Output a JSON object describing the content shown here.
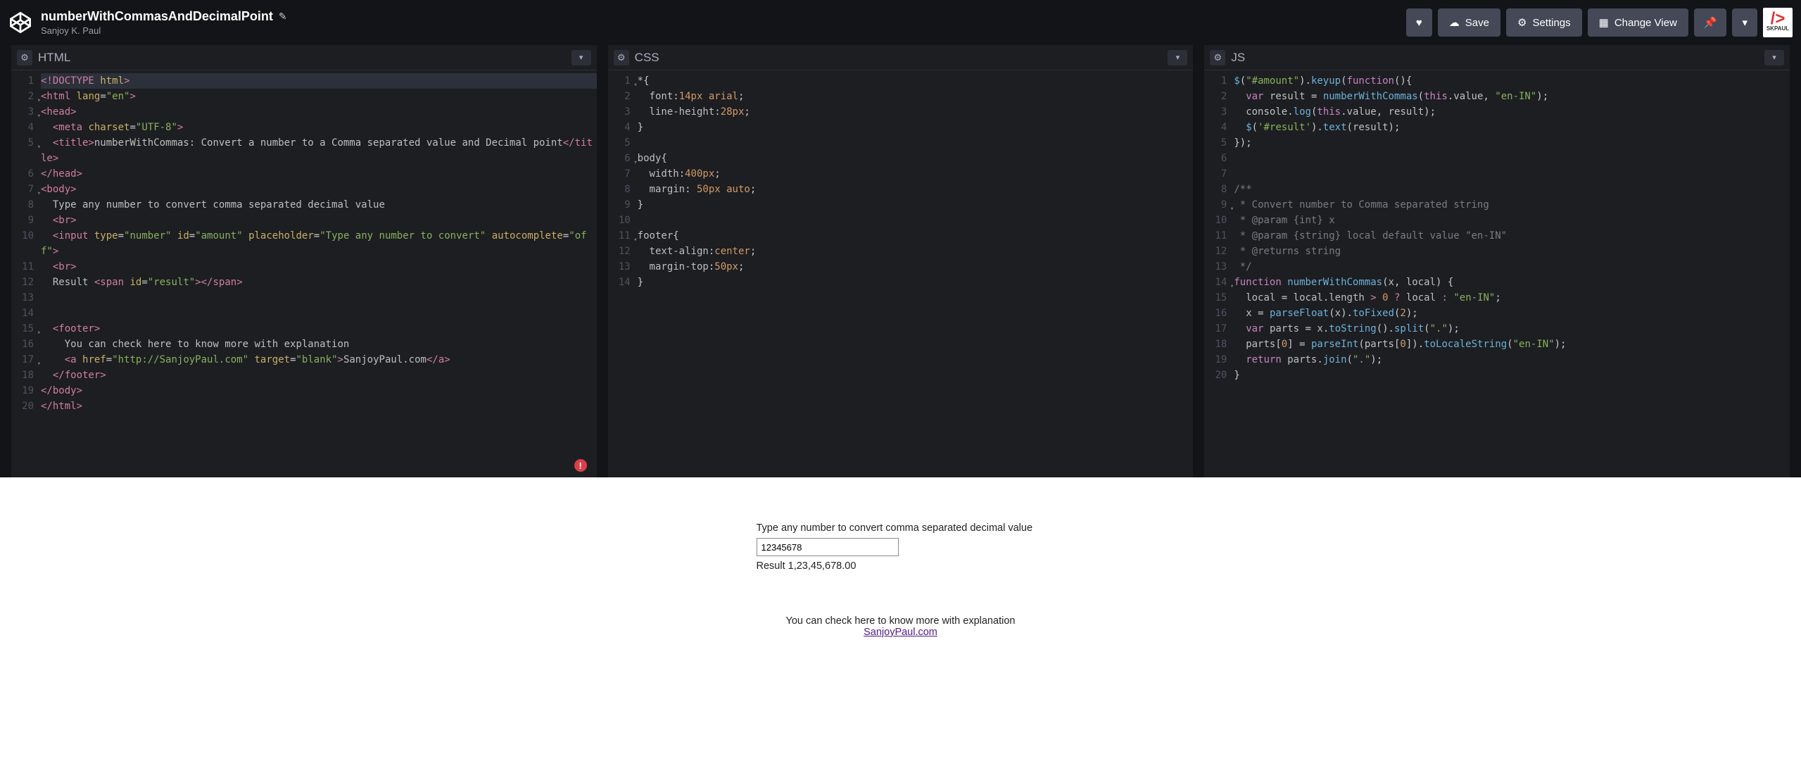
{
  "header": {
    "title": "numberWithCommasAndDecimalPoint",
    "author": "Sanjoy K. Paul",
    "save": "Save",
    "settings": "Settings",
    "changeView": "Change View",
    "avatarText": "SKPAUL"
  },
  "panes": {
    "html": {
      "title": "HTML"
    },
    "css": {
      "title": "CSS"
    },
    "js": {
      "title": "JS"
    }
  },
  "htmlLines": [
    {
      "n": "1",
      "cls": "cursor",
      "html": "<span class='tag'>&lt;!DOCTYPE</span> <span class='attr'>html</span><span class='tag'>&gt;</span>"
    },
    {
      "n": "2",
      "fold": true,
      "html": "<span class='tag'>&lt;html</span> <span class='attr'>lang</span>=<span class='str'>\"en\"</span><span class='tag'>&gt;</span>"
    },
    {
      "n": "3",
      "fold": true,
      "html": "<span class='tag'>&lt;head&gt;</span>"
    },
    {
      "n": "4",
      "html": "  <span class='tag'>&lt;meta</span> <span class='attr'>charset</span>=<span class='str'>\"UTF-8\"</span><span class='tag'>&gt;</span>"
    },
    {
      "n": "5",
      "fold": true,
      "html": "  <span class='tag'>&lt;title&gt;</span><span class='txt'>numberWithCommas: Convert a number to a Comma separated value and Decimal point</span><span class='tag'>&lt;/title&gt;</span>"
    },
    {
      "n": "6",
      "html": "<span class='tag'>&lt;/head&gt;</span>"
    },
    {
      "n": "7",
      "fold": true,
      "html": "<span class='tag'>&lt;body&gt;</span>"
    },
    {
      "n": "8",
      "html": "  <span class='txt'>Type any number to convert comma separated decimal value</span>"
    },
    {
      "n": "9",
      "html": "  <span class='tag'>&lt;br&gt;</span>"
    },
    {
      "n": "10",
      "html": "  <span class='tag'>&lt;input</span> <span class='attr'>type</span>=<span class='str'>\"number\"</span> <span class='attr'>id</span>=<span class='str'>\"amount\"</span> <span class='attr'>placeholder</span>=<span class='str'>\"Type any number to convert\"</span> <span class='attr'>autocomplete</span>=<span class='str'>\"off\"</span><span class='tag'>&gt;</span>"
    },
    {
      "n": "11",
      "html": "  <span class='tag'>&lt;br&gt;</span>"
    },
    {
      "n": "12",
      "html": "  <span class='txt'>Result </span><span class='tag'>&lt;span</span> <span class='attr'>id</span>=<span class='str'>\"result\"</span><span class='tag'>&gt;&lt;/span&gt;</span>"
    },
    {
      "n": "13",
      "html": "  "
    },
    {
      "n": "14",
      "html": "  "
    },
    {
      "n": "15",
      "fold": true,
      "html": "  <span class='tag'>&lt;footer&gt;</span>"
    },
    {
      "n": "16",
      "html": "    <span class='txt'>You can check here to know more with explanation</span>"
    },
    {
      "n": "17",
      "fold": true,
      "html": "    <span class='tag'>&lt;a</span> <span class='attr'>href</span>=<span class='str'>\"http://SanjoyPaul.com\"</span> <span class='attr'>target</span>=<span class='str'>\"blank\"</span><span class='tag'>&gt;</span><span class='txt'>SanjoyPaul.com</span><span class='tag'>&lt;/a&gt;</span>"
    },
    {
      "n": "18",
      "html": "  <span class='tag'>&lt;/footer&gt;</span>"
    },
    {
      "n": "19",
      "html": "<span class='tag'>&lt;/body&gt;</span>"
    },
    {
      "n": "20",
      "html": "<span class='tag'>&lt;/html&gt;</span>"
    }
  ],
  "cssLines": [
    {
      "n": "1",
      "fold": true,
      "html": "<span class='prop'>*</span>{"
    },
    {
      "n": "2",
      "html": "  <span class='prop'>font</span>:<span class='val'>14px</span> <span class='val'>arial</span>;"
    },
    {
      "n": "3",
      "html": "  <span class='prop'>line-height</span>:<span class='val'>28px</span>;"
    },
    {
      "n": "4",
      "html": "}"
    },
    {
      "n": "5",
      "html": ""
    },
    {
      "n": "6",
      "fold": true,
      "html": "<span class='prop'>body</span>{"
    },
    {
      "n": "7",
      "html": "  <span class='prop'>width</span>:<span class='val'>400px</span>;"
    },
    {
      "n": "8",
      "html": "  <span class='prop'>margin</span>: <span class='val'>50px</span> <span class='val'>auto</span>;"
    },
    {
      "n": "9",
      "html": "}"
    },
    {
      "n": "10",
      "html": ""
    },
    {
      "n": "11",
      "fold": true,
      "html": "<span class='prop'>footer</span>{"
    },
    {
      "n": "12",
      "html": "  <span class='prop'>text-align</span>:<span class='val'>center</span>;"
    },
    {
      "n": "13",
      "html": "  <span class='prop'>margin-top</span>:<span class='val'>50px</span>;"
    },
    {
      "n": "14",
      "html": "}"
    }
  ],
  "jsLines": [
    {
      "n": "1",
      "html": "<span class='fn'>$</span>(<span class='str'>\"#amount\"</span>).<span class='fn'>keyup</span>(<span class='kw'>function</span>(){"
    },
    {
      "n": "2",
      "html": "  <span class='kw'>var</span> <span class='var'>result</span> = <span class='fn'>numberWithCommas</span>(<span class='kw'>this</span>.<span class='var'>value</span>, <span class='str'>\"en-IN\"</span>);"
    },
    {
      "n": "3",
      "html": "  <span class='var'>console</span>.<span class='fn'>log</span>(<span class='kw'>this</span>.<span class='var'>value</span>, <span class='var'>result</span>);"
    },
    {
      "n": "4",
      "html": "  <span class='fn'>$</span>(<span class='str'>'#result'</span>).<span class='fn'>text</span>(<span class='var'>result</span>);"
    },
    {
      "n": "5",
      "html": "});"
    },
    {
      "n": "6",
      "html": ""
    },
    {
      "n": "7",
      "html": ""
    },
    {
      "n": "8",
      "html": "<span class='cmt'>/**</span>"
    },
    {
      "n": "9",
      "fold": true,
      "html": "<span class='cmt'> * Convert number to Comma separated string</span>"
    },
    {
      "n": "10",
      "html": "<span class='cmt'> * @param {int} x</span>"
    },
    {
      "n": "11",
      "html": "<span class='cmt'> * @param {string} local default value \"en-IN\"</span>"
    },
    {
      "n": "12",
      "html": "<span class='cmt'> * @returns string</span>"
    },
    {
      "n": "13",
      "html": "<span class='cmt'> */</span>"
    },
    {
      "n": "14",
      "fold": true,
      "html": "<span class='kw'>function</span> <span class='fn'>numberWithCommas</span>(<span class='var'>x</span>, <span class='var'>local</span>) {"
    },
    {
      "n": "15",
      "html": "  <span class='var'>local</span> = <span class='var'>local</span>.<span class='var'>length</span> <span class='op'>&gt;</span> <span class='num'>0</span> <span class='op'>?</span> <span class='var'>local</span> <span class='op'>:</span> <span class='str'>\"en-IN\"</span>;"
    },
    {
      "n": "16",
      "html": "  <span class='var'>x</span> = <span class='fn'>parseFloat</span>(<span class='var'>x</span>).<span class='fn'>toFixed</span>(<span class='num'>2</span>);"
    },
    {
      "n": "17",
      "html": "  <span class='kw'>var</span> <span class='var'>parts</span> = <span class='var'>x</span>.<span class='fn'>toString</span>().<span class='fn'>split</span>(<span class='str'>\".\"</span>);"
    },
    {
      "n": "18",
      "html": "  <span class='var'>parts</span>[<span class='num'>0</span>] = <span class='fn'>parseInt</span>(<span class='var'>parts</span>[<span class='num'>0</span>]).<span class='fn'>toLocaleString</span>(<span class='str'>\"en-IN\"</span>);"
    },
    {
      "n": "19",
      "html": "  <span class='kw'>return</span> <span class='var'>parts</span>.<span class='fn'>join</span>(<span class='str'>\".\"</span>);"
    },
    {
      "n": "20",
      "html": "}"
    }
  ],
  "output": {
    "label": "Type any number to convert comma separated decimal value",
    "inputValue": "12345678",
    "placeholder": "Type any number to convert",
    "resultPrefix": "Result ",
    "resultValue": "1,23,45,678.00",
    "footerText": "You can check here to know more with explanation",
    "footerLink": "SanjoyPaul.com"
  }
}
